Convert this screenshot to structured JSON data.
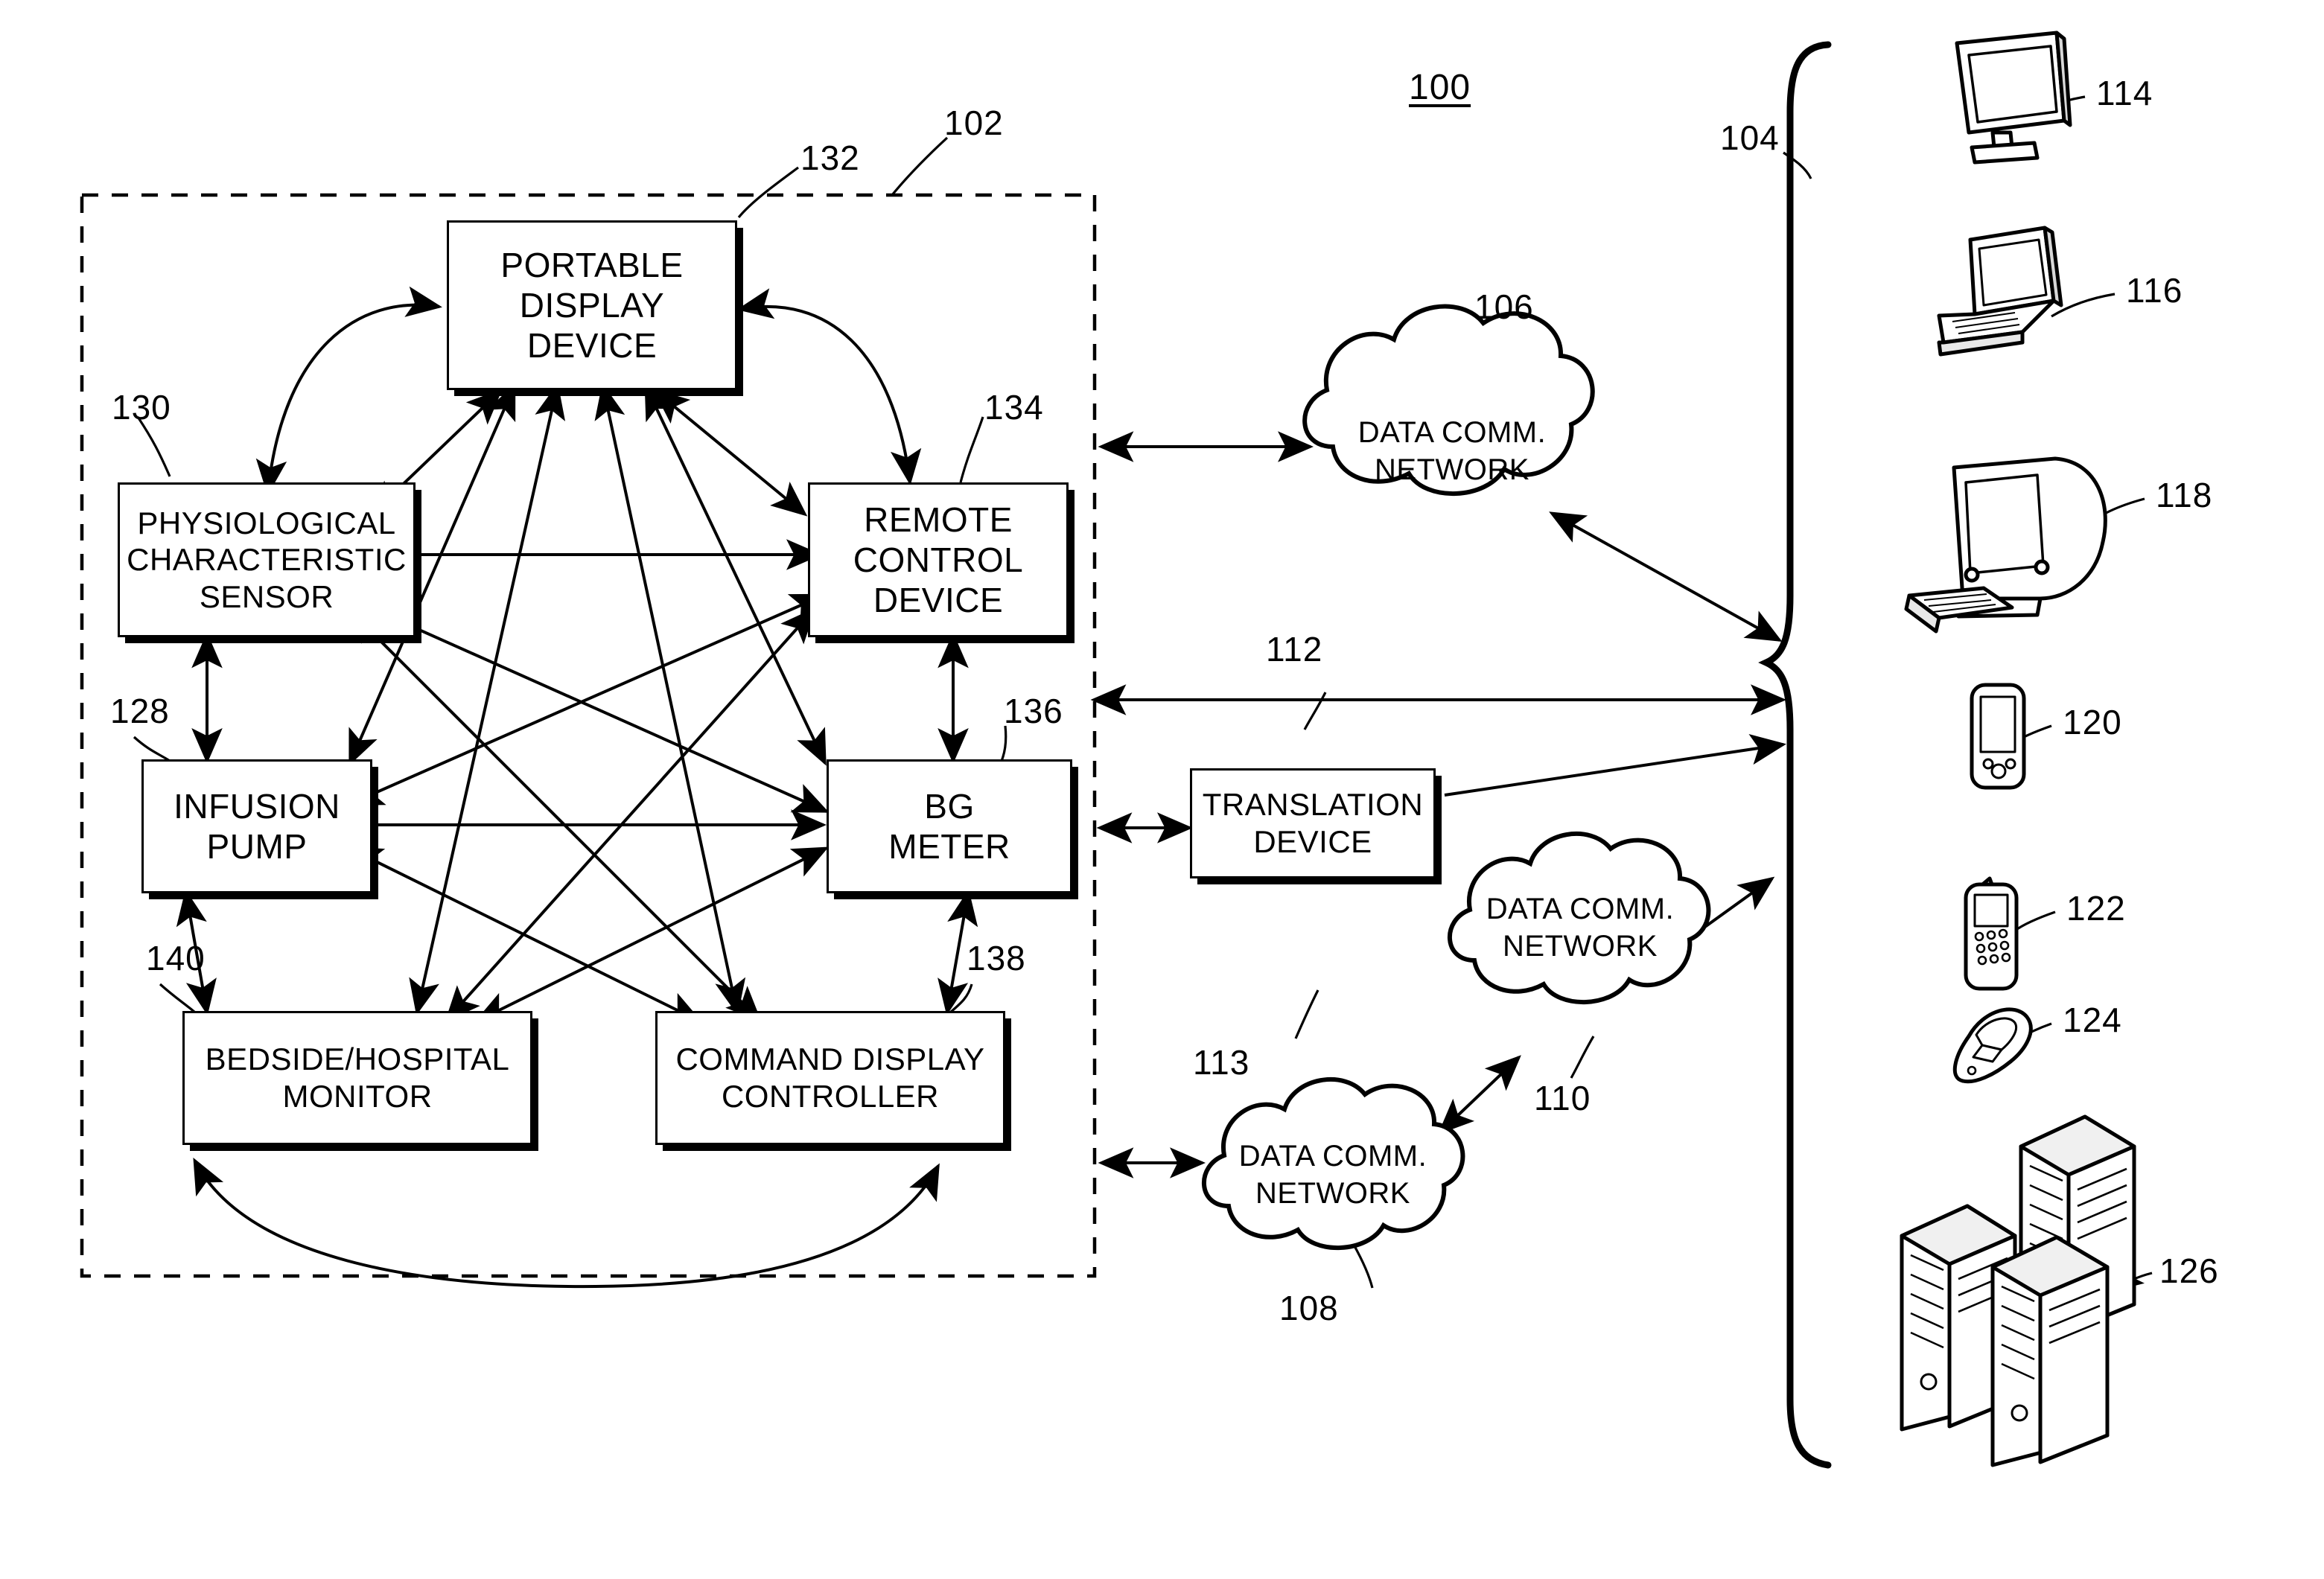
{
  "figure": {
    "number": "100",
    "system_bracket_label": "104",
    "patient_zone_label": "102",
    "direct_link_label": "112"
  },
  "inner_nodes": [
    {
      "id": "portable-display-device",
      "ref": "132",
      "lines": [
        "PORTABLE",
        "DISPLAY",
        "DEVICE"
      ]
    },
    {
      "id": "physiological-characteristic-sensor",
      "ref": "130",
      "lines": [
        "PHYSIOLOGICAL",
        "CHARACTERISTIC",
        "SENSOR"
      ]
    },
    {
      "id": "remote-control-device",
      "ref": "134",
      "lines": [
        "REMOTE",
        "CONTROL",
        "DEVICE"
      ]
    },
    {
      "id": "infusion-pump",
      "ref": "128",
      "lines": [
        "INFUSION",
        "PUMP"
      ]
    },
    {
      "id": "bg-meter",
      "ref": "136",
      "lines": [
        "BG",
        "METER"
      ]
    },
    {
      "id": "bedside-hospital-monitor",
      "ref": "140",
      "lines": [
        "BEDSIDE/HOSPITAL",
        "MONITOR"
      ]
    },
    {
      "id": "command-display-controller",
      "ref": "138",
      "lines": [
        "COMMAND DISPLAY",
        "CONTROLLER"
      ]
    }
  ],
  "translation_device": {
    "ref": "113",
    "lines": [
      "TRANSLATION",
      "DEVICE"
    ]
  },
  "networks": [
    {
      "id": "network-106",
      "ref": "106",
      "lines": [
        "DATA COMM.",
        "NETWORK"
      ]
    },
    {
      "id": "network-110",
      "ref": "110",
      "lines": [
        "DATA COMM.",
        "NETWORK"
      ]
    },
    {
      "id": "network-108",
      "ref": "108",
      "lines": [
        "DATA COMM.",
        "NETWORK"
      ]
    }
  ],
  "remote_devices": [
    {
      "id": "flat-monitor",
      "ref": "114",
      "icon": "flat-monitor-icon"
    },
    {
      "id": "laptop",
      "ref": "116",
      "icon": "laptop-icon"
    },
    {
      "id": "desktop-computer",
      "ref": "118",
      "icon": "desktop-computer-icon"
    },
    {
      "id": "pda",
      "ref": "120",
      "icon": "pda-icon"
    },
    {
      "id": "cell-phone",
      "ref": "122",
      "icon": "cell-phone-icon"
    },
    {
      "id": "flip-phone",
      "ref": "124",
      "icon": "flip-phone-icon"
    },
    {
      "id": "server-stack",
      "ref": "126",
      "icon": "server-stack-icon"
    }
  ],
  "colors": {
    "ink": "#000000",
    "paper": "#ffffff"
  }
}
